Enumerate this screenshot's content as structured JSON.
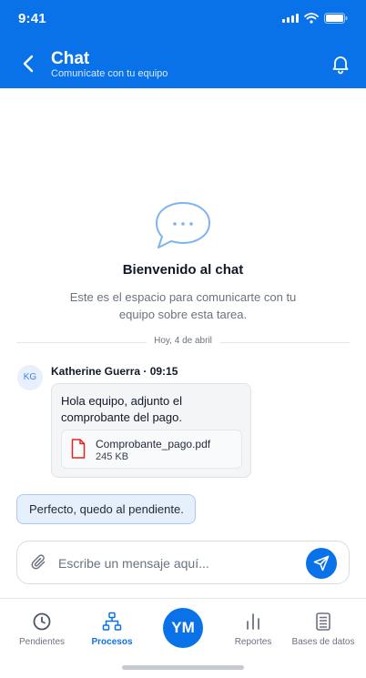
{
  "status_bar": {
    "time": "9:41"
  },
  "header": {
    "title": "Chat",
    "subtitle": "Comunícate con tu equipo"
  },
  "welcome": {
    "title": "Bienvenido al chat",
    "text": "Este es el espacio para comunicarte con tu equipo sobre esta tarea."
  },
  "date_divider": "Hoy, 4 de abril",
  "messages": [
    {
      "avatar": "KG",
      "sender": "Katherine Guerra · 09:15",
      "text": "Hola equipo, adjunto el comprobante del pago.",
      "attachment": {
        "name": "Comprobante_pago.pdf",
        "size": "245 KB",
        "icon": "pdf-file-icon"
      }
    },
    {
      "text": "Perfecto, quedo al pendiente."
    }
  ],
  "composer": {
    "placeholder": "Escribe un mensaje aquí...",
    "value": ""
  },
  "bottom_nav": {
    "items": [
      {
        "label": "Pendientes",
        "icon": "clock-icon"
      },
      {
        "label": "Procesos",
        "icon": "hierarchy-icon",
        "active": true
      },
      {
        "label": "YM",
        "icon": "user-avatar"
      },
      {
        "label": "Reportes",
        "icon": "bar-chart-icon"
      },
      {
        "label": "Bases de datos",
        "icon": "database-icon"
      }
    ]
  },
  "colors": {
    "primary": "#0a72e8",
    "outgoing_bubble": "#e6f0fc",
    "incoming_bubble": "#f4f5f7",
    "pdf_red": "#e02424"
  }
}
